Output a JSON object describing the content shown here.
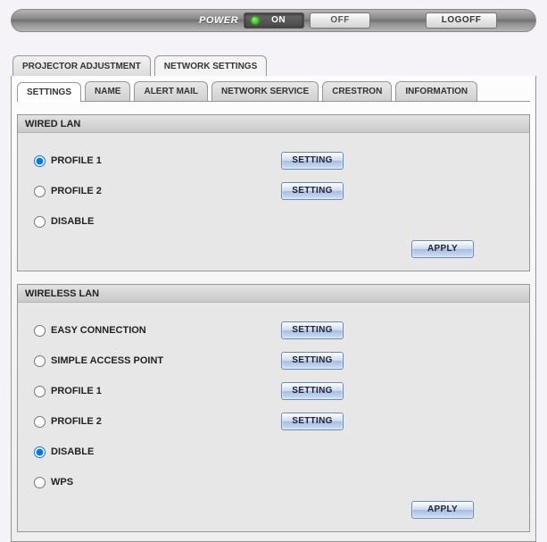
{
  "power_bar": {
    "label": "POWER",
    "on": "ON",
    "off": "OFF",
    "logoff": "LOGOFF"
  },
  "tabs1": {
    "projector_adjustment": "PROJECTOR ADJUSTMENT",
    "network_settings": "NETWORK SETTINGS"
  },
  "tabs2": {
    "settings": "SETTINGS",
    "name": "NAME",
    "alert_mail": "ALERT MAIL",
    "network_service": "NETWORK SERVICE",
    "crestron": "CRESTRON",
    "information": "INFORMATION"
  },
  "wired": {
    "title": "WIRED LAN",
    "profile1": "PROFILE 1",
    "profile2": "PROFILE 2",
    "disable": "DISABLE",
    "setting_btn": "SETTING",
    "apply_btn": "APPLY"
  },
  "wireless": {
    "title": "WIRELESS LAN",
    "easy": "EASY CONNECTION",
    "simple_ap": "SIMPLE ACCESS POINT",
    "profile1": "PROFILE 1",
    "profile2": "PROFILE 2",
    "disable": "DISABLE",
    "wps": "WPS",
    "setting_btn": "SETTING",
    "apply_btn": "APPLY"
  }
}
